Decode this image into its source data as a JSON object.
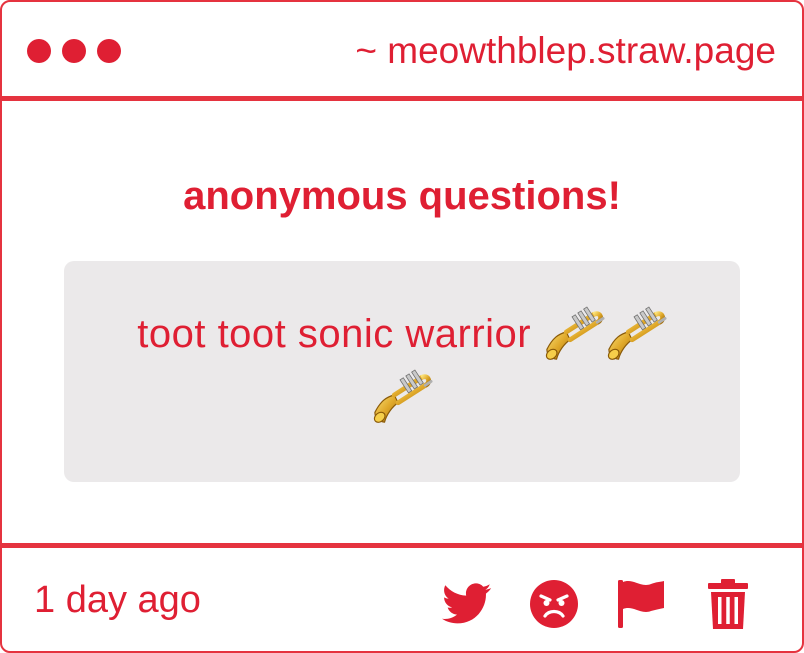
{
  "header": {
    "site_url": "~ meowthblep.straw.page",
    "window_dots": 3
  },
  "main": {
    "title": "anonymous questions!",
    "question": {
      "text": "toot toot sonic warrior",
      "emoji": [
        "trumpet",
        "trumpet",
        "trumpet"
      ]
    }
  },
  "footer": {
    "timestamp": "1 day ago",
    "actions": [
      {
        "name": "twitter-icon"
      },
      {
        "name": "angry-face-icon"
      },
      {
        "name": "flag-icon"
      },
      {
        "name": "trash-icon"
      }
    ]
  },
  "colors": {
    "accent": "#df1f33",
    "border": "#e5333f",
    "question_bg": "#ebe9ea"
  }
}
